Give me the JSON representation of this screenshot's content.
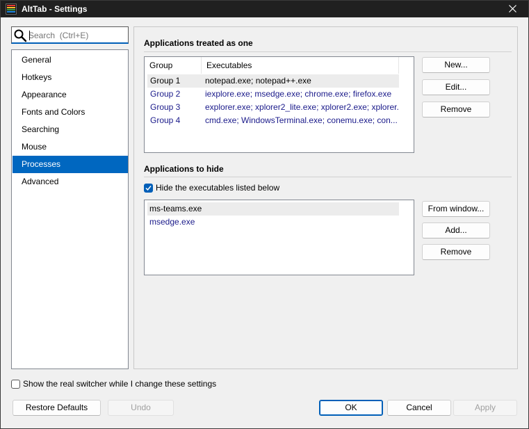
{
  "window": {
    "title": "AltTab - Settings",
    "close_icon": "close-icon"
  },
  "search": {
    "placeholder": "Search  (Ctrl+E)",
    "value": ""
  },
  "sidebar": {
    "items": [
      {
        "label": "General"
      },
      {
        "label": "Hotkeys"
      },
      {
        "label": "Appearance"
      },
      {
        "label": "Fonts and Colors"
      },
      {
        "label": "Searching"
      },
      {
        "label": "Mouse"
      },
      {
        "label": "Processes",
        "selected": true
      },
      {
        "label": "Advanced"
      }
    ]
  },
  "groups_section": {
    "title": "Applications treated as one",
    "columns": [
      "Group",
      "Executables"
    ],
    "rows": [
      {
        "group": "Group 1",
        "executables": "notepad.exe; notepad++.exe"
      },
      {
        "group": "Group 2",
        "executables": "iexplore.exe; msedge.exe; chrome.exe; firefox.exe"
      },
      {
        "group": "Group 3",
        "executables": "explorer.exe; xplorer2_lite.exe; xplorer2.exe; xplorer..."
      },
      {
        "group": "Group 4",
        "executables": "cmd.exe; WindowsTerminal.exe; conemu.exe; con..."
      }
    ],
    "buttons": {
      "new": "New...",
      "edit": "Edit...",
      "remove": "Remove"
    }
  },
  "hide_section": {
    "title": "Applications to hide",
    "checkbox_label": "Hide the executables listed below",
    "checkbox_checked": true,
    "items": [
      "ms-teams.exe",
      "msedge.exe"
    ],
    "buttons": {
      "from_window": "From window...",
      "add": "Add...",
      "remove": "Remove"
    }
  },
  "footer": {
    "show_switcher_label": "Show the real switcher while I change these settings",
    "show_switcher_checked": false,
    "restore_defaults": "Restore Defaults",
    "undo": "Undo",
    "ok": "OK",
    "cancel": "Cancel",
    "apply": "Apply"
  },
  "colors": {
    "accent": "#0067c0",
    "link_text": "#1a1a8a",
    "titlebar": "#202020"
  }
}
